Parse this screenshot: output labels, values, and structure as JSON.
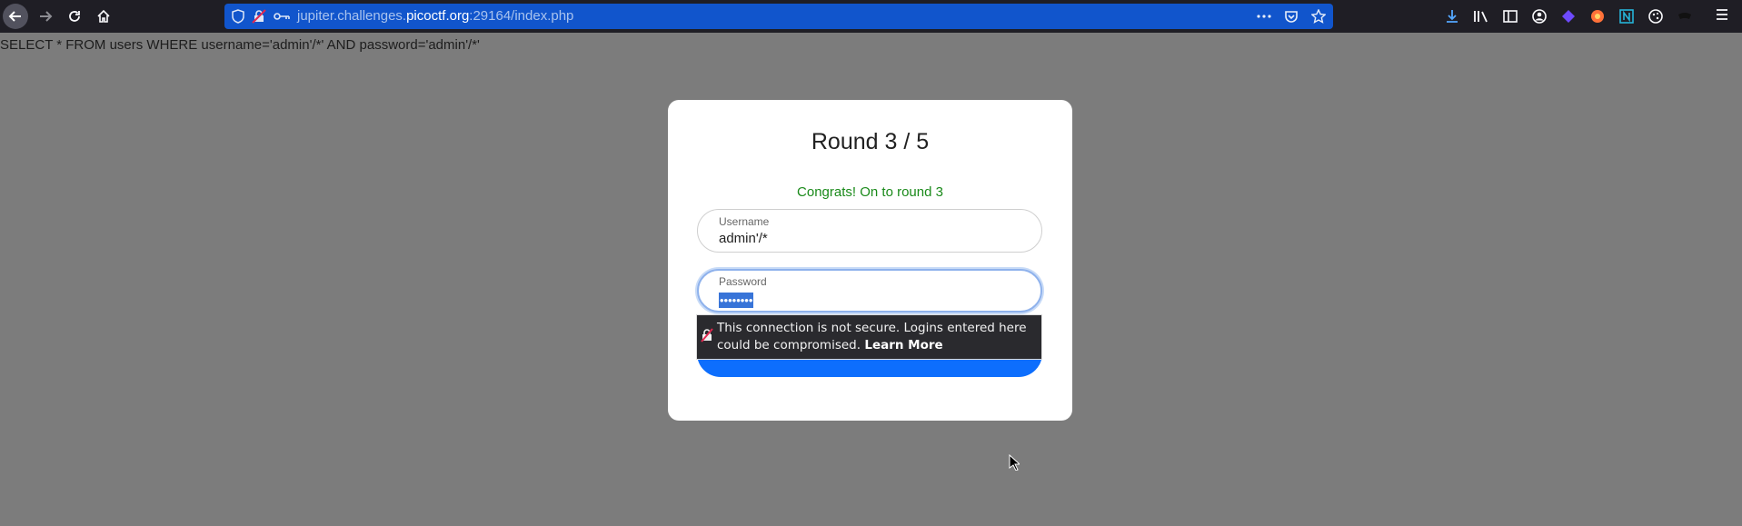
{
  "browser": {
    "url_prefix": "jupiter.challenges.",
    "url_host": "picoctf.org",
    "url_suffix": ":29164/index.php",
    "icons": {
      "back": "arrow-left-icon",
      "forward": "arrow-right-icon",
      "reload": "reload-icon",
      "home": "home-icon",
      "tracking": "shield-icon",
      "insecure": "insecure-lock-icon",
      "key": "key-icon",
      "more": "ellipsis-icon",
      "pocket": "pocket-icon",
      "bookmark": "star-icon",
      "downloads": "download-icon",
      "library": "library-icon",
      "sidebar": "sidebar-icon",
      "account": "account-icon",
      "extension1": "proton-extension-icon",
      "extension2": "firefox-relay-icon",
      "extension3": "notion-extension-icon",
      "extension4": "cookie-icon",
      "extension5": "mask-extension-icon",
      "menu": "hamburger-menu-icon"
    }
  },
  "page": {
    "sql_query": "SELECT * FROM users WHERE username='admin'/*' AND password='admin'/*'",
    "card": {
      "title": "Round 3 / 5",
      "congrats": "Congrats! On to round 3",
      "username_label": "Username",
      "username_value": "admin'/*",
      "password_label": "Password",
      "password_value": "••••••••",
      "colors": {
        "congrats": "#1a8a1a",
        "button": "#0d6efd"
      }
    },
    "warning": {
      "message": "This connection is not secure. Logins entered here could be compromised.",
      "link": "Learn More"
    }
  }
}
